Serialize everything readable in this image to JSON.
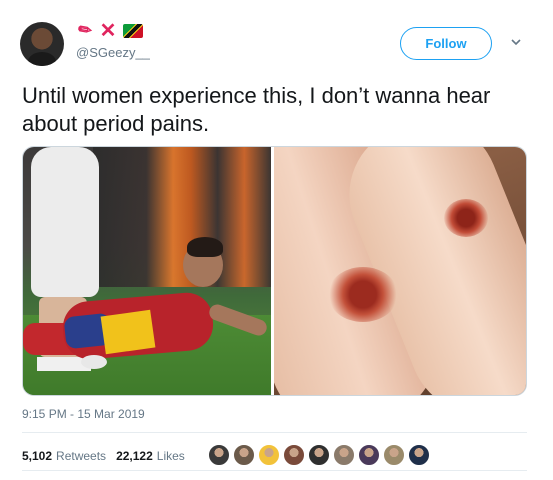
{
  "author": {
    "handle": "@SGeezy__",
    "name_emojis": [
      "pencil-icon",
      "cross-mark-icon",
      "saint-kitts-flag-icon"
    ]
  },
  "header": {
    "follow_label": "Follow"
  },
  "tweet": {
    "text": "Until women experience this, I don’t wanna hear about period pains.",
    "timestamp": "9:15 PM - 15 Mar 2019"
  },
  "stats": {
    "retweets_count": "5,102",
    "retweets_label": "Retweets",
    "likes_count": "22,122",
    "likes_label": "Likes"
  },
  "likers": [
    {
      "color": "#3a3a3a"
    },
    {
      "color": "#6b5a4a"
    },
    {
      "color": "#f2c23a"
    },
    {
      "color": "#7a4a3a"
    },
    {
      "color": "#2f2f2f"
    },
    {
      "color": "#8a7a6a"
    },
    {
      "color": "#4a3a5a"
    },
    {
      "color": "#9a8a6a"
    },
    {
      "color": "#1f2f4a"
    }
  ],
  "colors": {
    "accent": "#1da1f2",
    "text_primary": "#14171a",
    "text_secondary": "#657786"
  }
}
